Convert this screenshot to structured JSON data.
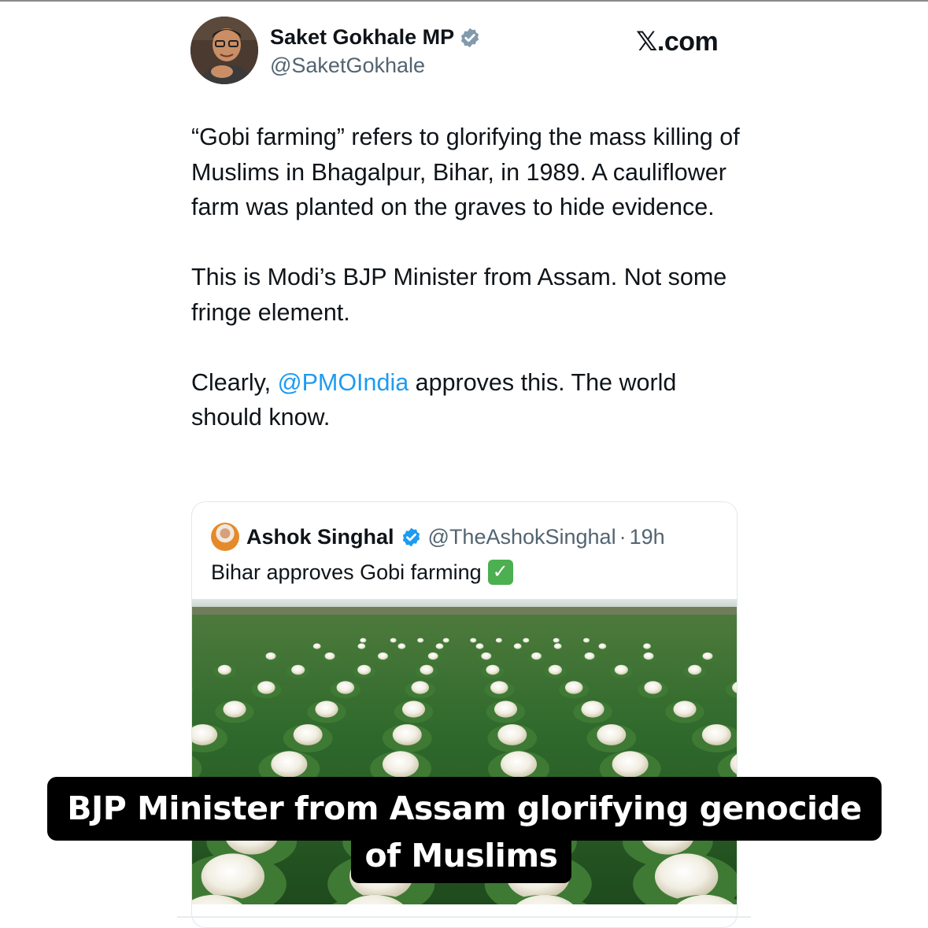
{
  "tweet": {
    "author_name": "Saket Gokhale MP",
    "author_handle": "@SaketGokhale",
    "site": "𝕏.com",
    "paragraphs": {
      "p1": "“Gobi farming” refers to glorifying the mass killing of Muslims in Bhagalpur, Bihar, in 1989. A cauliflower farm was planted on the graves to hide evidence.",
      "p2": "This is Modi’s BJP Minister from Assam. Not some fringe element.",
      "p3_before": "Clearly, ",
      "p3_mention": "@PMOIndia",
      "p3_after": " approves this. The world should know."
    }
  },
  "quote": {
    "author_name": "Ashok Singhal",
    "author_handle": "@TheAshokSinghal",
    "separator": "·",
    "time": "19h",
    "text": "Bihar approves Gobi farming",
    "emoji_icon": "check-mark-button-emoji"
  },
  "caption": {
    "line1": "BJP Minister from Assam glorifying genocide",
    "line2": "of Muslims"
  },
  "colors": {
    "link": "#1d9bf0",
    "verified": "#1d9bf0",
    "secondary_text": "#536471",
    "caption_bg": "#000000"
  }
}
